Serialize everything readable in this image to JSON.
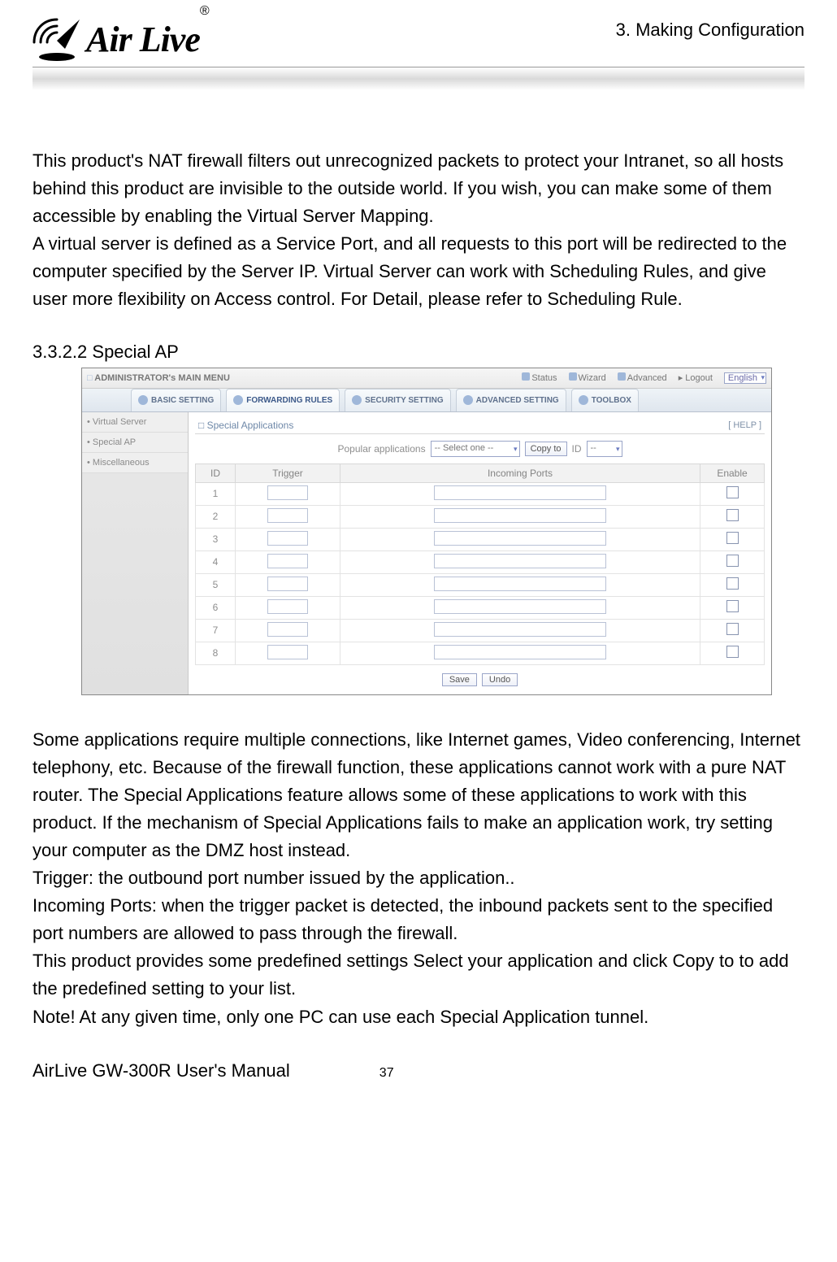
{
  "header": {
    "chapter": "3. Making Configuration",
    "logo_text": "Air Live",
    "logo_reg": "®"
  },
  "para1": "This product's NAT firewall filters out unrecognized packets to protect your Intranet, so all hosts behind this product are invisible to the outside world. If you wish, you can make some of them accessible by enabling the Virtual Server Mapping.",
  "para2": "A virtual server is defined as a Service Port, and all requests to this port will be redirected to the computer specified by the Server IP.   Virtual Server can work with Scheduling Rules, and give user more flexibility on Access control. For Detail, please refer to Scheduling Rule.",
  "section_heading": "3.3.2.2 Special AP",
  "screenshot": {
    "topbar": {
      "title": "ADMINISTRATOR's MAIN MENU",
      "items": [
        "Status",
        "Wizard",
        "Advanced",
        "Logout"
      ],
      "language": "English"
    },
    "tabs": [
      "BASIC SETTING",
      "FORWARDING RULES",
      "SECURITY SETTING",
      "ADVANCED SETTING",
      "TOOLBOX"
    ],
    "active_tab_index": 1,
    "sidebar": [
      "Virtual Server",
      "Special AP",
      "Miscellaneous"
    ],
    "panel": {
      "title": "Special Applications",
      "help": "[ HELP ]",
      "popular_label": "Popular applications",
      "popular_select": "-- Select one --",
      "copy_btn": "Copy to",
      "id_label": "ID",
      "id_select": "--",
      "columns": [
        "ID",
        "Trigger",
        "Incoming Ports",
        "Enable"
      ],
      "rows": [
        "1",
        "2",
        "3",
        "4",
        "5",
        "6",
        "7",
        "8"
      ],
      "save": "Save",
      "undo": "Undo"
    }
  },
  "after": {
    "p1": "Some applications require multiple connections, like Internet games, Video conferencing, Internet telephony, etc. Because of the firewall function, these applications cannot work with a pure NAT router. The Special Applications feature allows some of these applications to work with this product. If the mechanism of Special Applications fails to make an application work, try setting your computer as the DMZ host instead.",
    "p2": "Trigger: the outbound port number issued by the application..",
    "p3": "Incoming Ports: when the trigger packet is detected, the inbound packets sent to the specified port numbers are allowed to pass through the firewall.",
    "p4": "This product provides some predefined settings Select your application and click Copy to to add the predefined setting to your list.",
    "p5": "Note! At any given time, only one PC can use each Special Application tunnel."
  },
  "footer": {
    "manual": "AirLive GW-300R User's Manual",
    "page": "37"
  }
}
